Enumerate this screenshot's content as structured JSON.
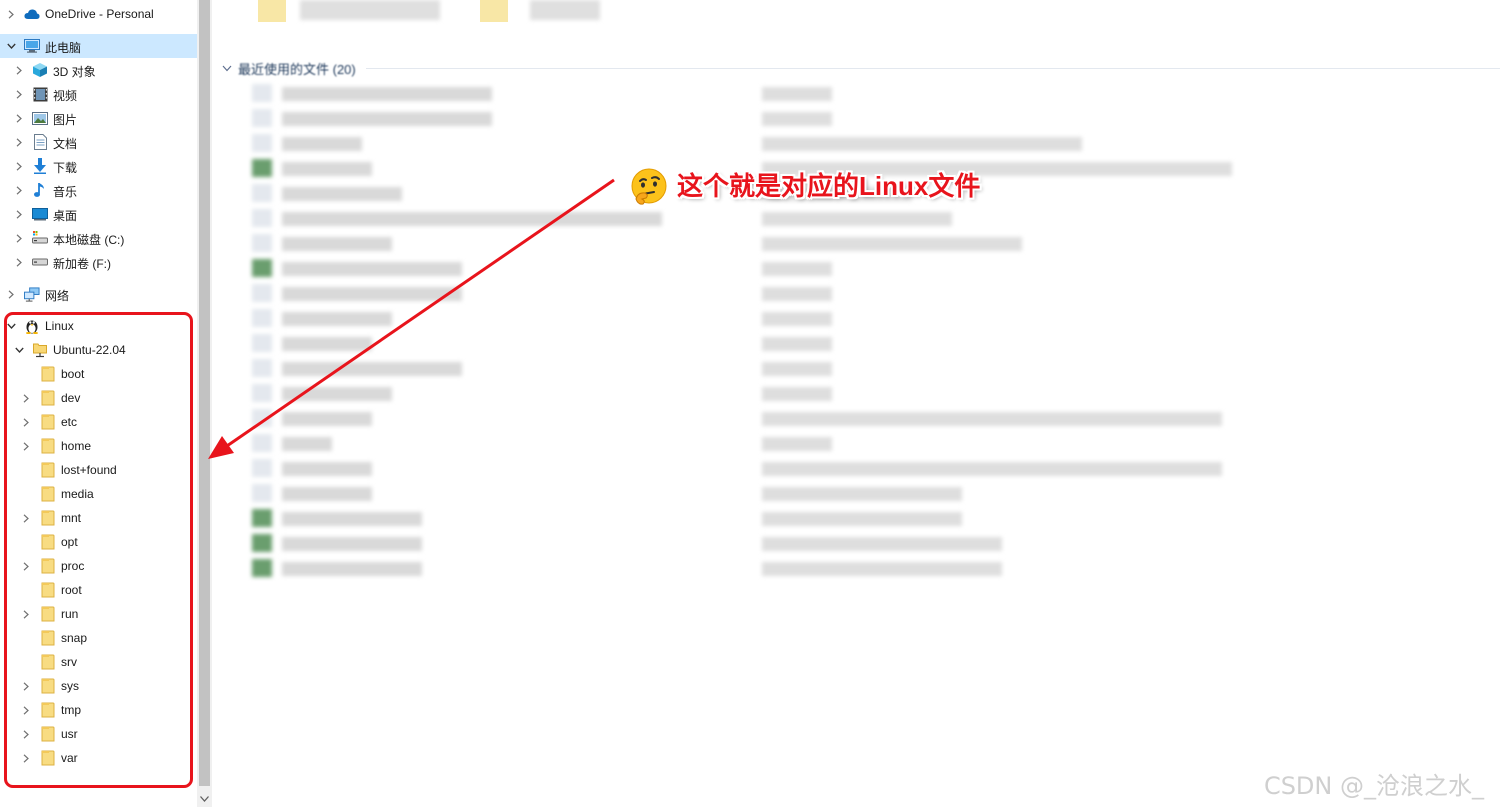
{
  "nav": {
    "items": [
      {
        "label": "OneDrive - Personal",
        "icon": "onedrive-cloud-icon",
        "expand": "collapsed",
        "level": 0,
        "selected": false
      },
      {
        "label": "此电脑",
        "icon": "this-pc-icon",
        "expand": "expanded",
        "level": 0,
        "selected": true
      },
      {
        "label": "3D 对象",
        "icon": "3d-objects-icon",
        "expand": "collapsed",
        "level": 1,
        "selected": false
      },
      {
        "label": "视频",
        "icon": "videos-icon",
        "expand": "collapsed",
        "level": 1,
        "selected": false
      },
      {
        "label": "图片",
        "icon": "pictures-icon",
        "expand": "collapsed",
        "level": 1,
        "selected": false
      },
      {
        "label": "文档",
        "icon": "documents-icon",
        "expand": "collapsed",
        "level": 1,
        "selected": false
      },
      {
        "label": "下载",
        "icon": "downloads-icon",
        "expand": "collapsed",
        "level": 1,
        "selected": false
      },
      {
        "label": "音乐",
        "icon": "music-icon",
        "expand": "collapsed",
        "level": 1,
        "selected": false
      },
      {
        "label": "桌面",
        "icon": "desktop-icon",
        "expand": "collapsed",
        "level": 1,
        "selected": false
      },
      {
        "label": "本地磁盘 (C:)",
        "icon": "local-disk-icon",
        "expand": "collapsed",
        "level": 1,
        "selected": false
      },
      {
        "label": "新加卷 (F:)",
        "icon": "drive-icon",
        "expand": "collapsed",
        "level": 1,
        "selected": false
      },
      {
        "label": "网络",
        "icon": "network-icon",
        "expand": "collapsed",
        "level": 0,
        "selected": false
      },
      {
        "label": "Linux",
        "icon": "linux-penguin-icon",
        "expand": "expanded",
        "level": 0,
        "selected": false
      },
      {
        "label": "Ubuntu-22.04",
        "icon": "network-share-icon",
        "expand": "expanded",
        "level": 1,
        "selected": false
      },
      {
        "label": "boot",
        "icon": "folder-icon",
        "expand": "none",
        "level": 2,
        "selected": false
      },
      {
        "label": "dev",
        "icon": "folder-icon",
        "expand": "collapsed",
        "level": 2,
        "selected": false
      },
      {
        "label": "etc",
        "icon": "folder-icon",
        "expand": "collapsed",
        "level": 2,
        "selected": false
      },
      {
        "label": "home",
        "icon": "folder-icon",
        "expand": "collapsed",
        "level": 2,
        "selected": false
      },
      {
        "label": "lost+found",
        "icon": "folder-icon",
        "expand": "none",
        "level": 2,
        "selected": false
      },
      {
        "label": "media",
        "icon": "folder-icon",
        "expand": "none",
        "level": 2,
        "selected": false
      },
      {
        "label": "mnt",
        "icon": "folder-icon",
        "expand": "collapsed",
        "level": 2,
        "selected": false
      },
      {
        "label": "opt",
        "icon": "folder-icon",
        "expand": "none",
        "level": 2,
        "selected": false
      },
      {
        "label": "proc",
        "icon": "folder-icon",
        "expand": "collapsed",
        "level": 2,
        "selected": false
      },
      {
        "label": "root",
        "icon": "folder-icon",
        "expand": "none",
        "level": 2,
        "selected": false
      },
      {
        "label": "run",
        "icon": "folder-icon",
        "expand": "collapsed",
        "level": 2,
        "selected": false
      },
      {
        "label": "snap",
        "icon": "folder-icon",
        "expand": "none",
        "level": 2,
        "selected": false
      },
      {
        "label": "srv",
        "icon": "folder-icon",
        "expand": "none",
        "level": 2,
        "selected": false
      },
      {
        "label": "sys",
        "icon": "folder-icon",
        "expand": "collapsed",
        "level": 2,
        "selected": false
      },
      {
        "label": "tmp",
        "icon": "folder-icon",
        "expand": "collapsed",
        "level": 2,
        "selected": false
      },
      {
        "label": "usr",
        "icon": "folder-icon",
        "expand": "collapsed",
        "level": 2,
        "selected": false
      },
      {
        "label": "var",
        "icon": "folder-icon",
        "expand": "collapsed",
        "level": 2,
        "selected": false
      }
    ]
  },
  "content": {
    "recent_header": "最近使用的文件 (20)"
  },
  "annotation": {
    "text": "这个就是对应的Linux文件",
    "emoji": "thinking-face-icon",
    "color": "#e8141c"
  },
  "watermark": "CSDN @_沧浪之水_"
}
